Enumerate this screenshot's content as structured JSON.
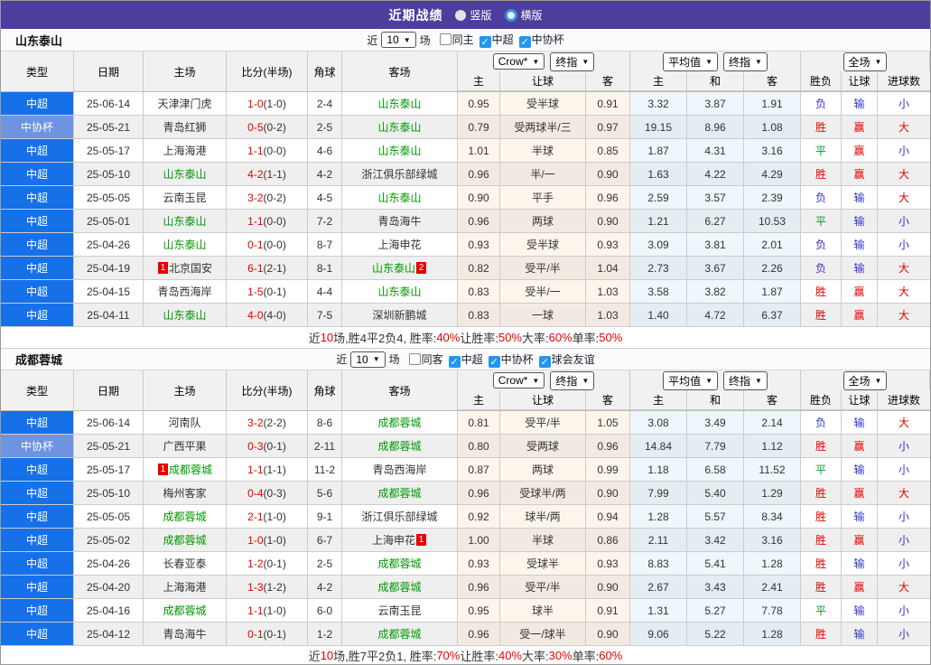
{
  "title_bar": {
    "title": "近期战绩",
    "radios": [
      {
        "label": "竖版",
        "selected": false
      },
      {
        "label": "横版",
        "selected": true
      }
    ]
  },
  "colors": {
    "result_map": {
      "r": "#e60000",
      "g": "#009933",
      "b": "#3333cc"
    },
    "team_green": "#009900",
    "league_bg": "#1670e8",
    "cup_bg": "#6e93e0",
    "accent_purple": "#4c3f9c",
    "checkbox_blue": "#2196f3",
    "score_red": "#e60000"
  },
  "table_header": {
    "cols": [
      "类型",
      "日期",
      "主场",
      "比分(半场)",
      "角球",
      "客场"
    ],
    "groups": [
      {
        "col": 7,
        "selects": [
          "Crow*",
          "终指"
        ]
      },
      {
        "col": 10,
        "selects": [
          "平均值",
          "终指"
        ]
      },
      {
        "col": 13,
        "selects": [
          "全场"
        ]
      }
    ],
    "sub": [
      "主",
      "让球",
      "客",
      "主",
      "和",
      "客",
      "胜负",
      "让球",
      "进球数"
    ]
  },
  "sections": [
    {
      "team": "山东泰山",
      "filters": {
        "prefix": "近",
        "count": "10",
        "suffix": "场",
        "checkboxes": [
          {
            "label": "同主",
            "checked": false
          },
          {
            "label": "中超",
            "checked": true
          },
          {
            "label": "中协杯",
            "checked": true
          }
        ]
      },
      "rows": [
        {
          "type": "中超",
          "cup": false,
          "date": "25-06-14",
          "home": {
            "name": "天津津门虎",
            "green": false
          },
          "score": "1-0",
          "half": "(1-0)",
          "corner": "2-4",
          "away": {
            "name": "山东泰山",
            "green": true
          },
          "o1": "0.95",
          "line": "受半球",
          "o2": "0.91",
          "a1": "3.32",
          "a2": "3.87",
          "a3": "1.91",
          "res": {
            "t": "负",
            "c": "b"
          },
          "hres": {
            "t": "输",
            "c": "b"
          },
          "gres": {
            "t": "小",
            "c": "b"
          }
        },
        {
          "type": "中协杯",
          "cup": true,
          "date": "25-05-21",
          "home": {
            "name": "青岛红狮",
            "green": false
          },
          "score": "0-5",
          "half": "(0-2)",
          "corner": "2-5",
          "away": {
            "name": "山东泰山",
            "green": true
          },
          "o1": "0.79",
          "line": "受两球半/三",
          "o2": "0.97",
          "a1": "19.15",
          "a2": "8.96",
          "a3": "1.08",
          "res": {
            "t": "胜",
            "c": "r"
          },
          "hres": {
            "t": "赢",
            "c": "r"
          },
          "gres": {
            "t": "大",
            "c": "r"
          }
        },
        {
          "type": "中超",
          "cup": false,
          "date": "25-05-17",
          "home": {
            "name": "上海海港",
            "green": false
          },
          "score": "1-1",
          "half": "(0-0)",
          "corner": "4-6",
          "away": {
            "name": "山东泰山",
            "green": true
          },
          "o1": "1.01",
          "line": "半球",
          "o2": "0.85",
          "a1": "1.87",
          "a2": "4.31",
          "a3": "3.16",
          "res": {
            "t": "平",
            "c": "g"
          },
          "hres": {
            "t": "赢",
            "c": "r"
          },
          "gres": {
            "t": "小",
            "c": "b"
          }
        },
        {
          "type": "中超",
          "cup": false,
          "date": "25-05-10",
          "home": {
            "name": "山东泰山",
            "green": true
          },
          "score": "4-2",
          "half": "(1-1)",
          "corner": "4-2",
          "away": {
            "name": "浙江俱乐部绿城",
            "green": false
          },
          "o1": "0.96",
          "line": "半/一",
          "o2": "0.90",
          "a1": "1.63",
          "a2": "4.22",
          "a3": "4.29",
          "res": {
            "t": "胜",
            "c": "r"
          },
          "hres": {
            "t": "赢",
            "c": "r"
          },
          "gres": {
            "t": "大",
            "c": "r"
          }
        },
        {
          "type": "中超",
          "cup": false,
          "date": "25-05-05",
          "home": {
            "name": "云南玉昆",
            "green": false
          },
          "score": "3-2",
          "half": "(0-2)",
          "corner": "4-5",
          "away": {
            "name": "山东泰山",
            "green": true
          },
          "o1": "0.90",
          "line": "平手",
          "o2": "0.96",
          "a1": "2.59",
          "a2": "3.57",
          "a3": "2.39",
          "res": {
            "t": "负",
            "c": "b"
          },
          "hres": {
            "t": "输",
            "c": "b"
          },
          "gres": {
            "t": "大",
            "c": "r"
          }
        },
        {
          "type": "中超",
          "cup": false,
          "date": "25-05-01",
          "home": {
            "name": "山东泰山",
            "green": true
          },
          "score": "1-1",
          "half": "(0-0)",
          "corner": "7-2",
          "away": {
            "name": "青岛海牛",
            "green": false
          },
          "o1": "0.96",
          "line": "两球",
          "o2": "0.90",
          "a1": "1.21",
          "a2": "6.27",
          "a3": "10.53",
          "res": {
            "t": "平",
            "c": "g"
          },
          "hres": {
            "t": "输",
            "c": "b"
          },
          "gres": {
            "t": "小",
            "c": "b"
          }
        },
        {
          "type": "中超",
          "cup": false,
          "date": "25-04-26",
          "home": {
            "name": "山东泰山",
            "green": true
          },
          "score": "0-1",
          "half": "(0-0)",
          "corner": "8-7",
          "away": {
            "name": "上海申花",
            "green": false
          },
          "o1": "0.93",
          "line": "受半球",
          "o2": "0.93",
          "a1": "3.09",
          "a2": "3.81",
          "a3": "2.01",
          "res": {
            "t": "负",
            "c": "b"
          },
          "hres": {
            "t": "输",
            "c": "b"
          },
          "gres": {
            "t": "小",
            "c": "b"
          }
        },
        {
          "type": "中超",
          "cup": false,
          "date": "25-04-19",
          "home": {
            "name": "北京国安",
            "green": false,
            "badge_before": "1"
          },
          "score": "6-1",
          "half": "(2-1)",
          "corner": "8-1",
          "away": {
            "name": "山东泰山",
            "green": true,
            "badge_after": "2"
          },
          "o1": "0.82",
          "line": "受平/半",
          "o2": "1.04",
          "a1": "2.73",
          "a2": "3.67",
          "a3": "2.26",
          "res": {
            "t": "负",
            "c": "b"
          },
          "hres": {
            "t": "输",
            "c": "b"
          },
          "gres": {
            "t": "大",
            "c": "r"
          }
        },
        {
          "type": "中超",
          "cup": false,
          "date": "25-04-15",
          "home": {
            "name": "青岛西海岸",
            "green": false
          },
          "score": "1-5",
          "half": "(0-1)",
          "corner": "4-4",
          "away": {
            "name": "山东泰山",
            "green": true
          },
          "o1": "0.83",
          "line": "受半/一",
          "o2": "1.03",
          "a1": "3.58",
          "a2": "3.82",
          "a3": "1.87",
          "res": {
            "t": "胜",
            "c": "r"
          },
          "hres": {
            "t": "赢",
            "c": "r"
          },
          "gres": {
            "t": "大",
            "c": "r"
          }
        },
        {
          "type": "中超",
          "cup": false,
          "date": "25-04-11",
          "home": {
            "name": "山东泰山",
            "green": true
          },
          "score": "4-0",
          "half": "(4-0)",
          "corner": "7-5",
          "away": {
            "name": "深圳新鹏城",
            "green": false
          },
          "o1": "0.83",
          "line": "一球",
          "o2": "1.03",
          "a1": "1.40",
          "a2": "4.72",
          "a3": "6.37",
          "res": {
            "t": "胜",
            "c": "r"
          },
          "hres": {
            "t": "赢",
            "c": "r"
          },
          "gres": {
            "t": "大",
            "c": "r"
          }
        }
      ],
      "summary": [
        {
          "t": "近"
        },
        {
          "t": "10",
          "red": true
        },
        {
          "t": "场,胜4平2负4, 胜率:"
        },
        {
          "t": "40%",
          "red": true
        },
        {
          "t": " 让胜率:"
        },
        {
          "t": "50%",
          "red": true
        },
        {
          "t": " 大率:"
        },
        {
          "t": "60%",
          "red": true
        },
        {
          "t": " 单率:"
        },
        {
          "t": "50%",
          "red": true
        }
      ]
    },
    {
      "team": "成都蓉城",
      "filters": {
        "prefix": "近",
        "count": "10",
        "suffix": "场",
        "checkboxes": [
          {
            "label": "同客",
            "checked": false
          },
          {
            "label": "中超",
            "checked": true
          },
          {
            "label": "中协杯",
            "checked": true
          },
          {
            "label": "球会友谊",
            "checked": true
          }
        ]
      },
      "rows": [
        {
          "type": "中超",
          "cup": false,
          "date": "25-06-14",
          "home": {
            "name": "河南队",
            "green": false
          },
          "score": "3-2",
          "half": "(2-2)",
          "corner": "8-6",
          "away": {
            "name": "成都蓉城",
            "green": true
          },
          "o1": "0.81",
          "line": "受平/半",
          "o2": "1.05",
          "a1": "3.08",
          "a2": "3.49",
          "a3": "2.14",
          "res": {
            "t": "负",
            "c": "b"
          },
          "hres": {
            "t": "输",
            "c": "b"
          },
          "gres": {
            "t": "大",
            "c": "r"
          }
        },
        {
          "type": "中协杯",
          "cup": true,
          "date": "25-05-21",
          "home": {
            "name": "广西平果",
            "green": false
          },
          "score": "0-3",
          "half": "(0-1)",
          "corner": "2-11",
          "away": {
            "name": "成都蓉城",
            "green": true
          },
          "o1": "0.80",
          "line": "受两球",
          "o2": "0.96",
          "a1": "14.84",
          "a2": "7.79",
          "a3": "1.12",
          "res": {
            "t": "胜",
            "c": "r"
          },
          "hres": {
            "t": "赢",
            "c": "r"
          },
          "gres": {
            "t": "小",
            "c": "b"
          }
        },
        {
          "type": "中超",
          "cup": false,
          "date": "25-05-17",
          "home": {
            "name": "成都蓉城",
            "green": true,
            "badge_before": "1"
          },
          "score": "1-1",
          "half": "(1-1)",
          "corner": "11-2",
          "away": {
            "name": "青岛西海岸",
            "green": false
          },
          "o1": "0.87",
          "line": "两球",
          "o2": "0.99",
          "a1": "1.18",
          "a2": "6.58",
          "a3": "11.52",
          "res": {
            "t": "平",
            "c": "g"
          },
          "hres": {
            "t": "输",
            "c": "b"
          },
          "gres": {
            "t": "小",
            "c": "b"
          }
        },
        {
          "type": "中超",
          "cup": false,
          "date": "25-05-10",
          "home": {
            "name": "梅州客家",
            "green": false
          },
          "score": "0-4",
          "half": "(0-3)",
          "corner": "5-6",
          "away": {
            "name": "成都蓉城",
            "green": true
          },
          "o1": "0.96",
          "line": "受球半/两",
          "o2": "0.90",
          "a1": "7.99",
          "a2": "5.40",
          "a3": "1.29",
          "res": {
            "t": "胜",
            "c": "r"
          },
          "hres": {
            "t": "赢",
            "c": "r"
          },
          "gres": {
            "t": "大",
            "c": "r"
          }
        },
        {
          "type": "中超",
          "cup": false,
          "date": "25-05-05",
          "home": {
            "name": "成都蓉城",
            "green": true
          },
          "score": "2-1",
          "half": "(1-0)",
          "corner": "9-1",
          "away": {
            "name": "浙江俱乐部绿城",
            "green": false
          },
          "o1": "0.92",
          "line": "球半/两",
          "o2": "0.94",
          "a1": "1.28",
          "a2": "5.57",
          "a3": "8.34",
          "res": {
            "t": "胜",
            "c": "r"
          },
          "hres": {
            "t": "输",
            "c": "b"
          },
          "gres": {
            "t": "小",
            "c": "b"
          }
        },
        {
          "type": "中超",
          "cup": false,
          "date": "25-05-02",
          "home": {
            "name": "成都蓉城",
            "green": true
          },
          "score": "1-0",
          "half": "(1-0)",
          "corner": "6-7",
          "away": {
            "name": "上海申花",
            "green": false,
            "badge_after": "1"
          },
          "o1": "1.00",
          "line": "半球",
          "o2": "0.86",
          "a1": "2.11",
          "a2": "3.42",
          "a3": "3.16",
          "res": {
            "t": "胜",
            "c": "r"
          },
          "hres": {
            "t": "赢",
            "c": "r"
          },
          "gres": {
            "t": "小",
            "c": "b"
          }
        },
        {
          "type": "中超",
          "cup": false,
          "date": "25-04-26",
          "home": {
            "name": "长春亚泰",
            "green": false
          },
          "score": "1-2",
          "half": "(0-1)",
          "corner": "2-5",
          "away": {
            "name": "成都蓉城",
            "green": true
          },
          "o1": "0.93",
          "line": "受球半",
          "o2": "0.93",
          "a1": "8.83",
          "a2": "5.41",
          "a3": "1.28",
          "res": {
            "t": "胜",
            "c": "r"
          },
          "hres": {
            "t": "输",
            "c": "b"
          },
          "gres": {
            "t": "小",
            "c": "b"
          }
        },
        {
          "type": "中超",
          "cup": false,
          "date": "25-04-20",
          "home": {
            "name": "上海海港",
            "green": false
          },
          "score": "1-3",
          "half": "(1-2)",
          "corner": "4-2",
          "away": {
            "name": "成都蓉城",
            "green": true
          },
          "o1": "0.96",
          "line": "受平/半",
          "o2": "0.90",
          "a1": "2.67",
          "a2": "3.43",
          "a3": "2.41",
          "res": {
            "t": "胜",
            "c": "r"
          },
          "hres": {
            "t": "赢",
            "c": "r"
          },
          "gres": {
            "t": "大",
            "c": "r"
          }
        },
        {
          "type": "中超",
          "cup": false,
          "date": "25-04-16",
          "home": {
            "name": "成都蓉城",
            "green": true
          },
          "score": "1-1",
          "half": "(1-0)",
          "corner": "6-0",
          "away": {
            "name": "云南玉昆",
            "green": false
          },
          "o1": "0.95",
          "line": "球半",
          "o2": "0.91",
          "a1": "1.31",
          "a2": "5.27",
          "a3": "7.78",
          "res": {
            "t": "平",
            "c": "g"
          },
          "hres": {
            "t": "输",
            "c": "b"
          },
          "gres": {
            "t": "小",
            "c": "b"
          }
        },
        {
          "type": "中超",
          "cup": false,
          "date": "25-04-12",
          "home": {
            "name": "青岛海牛",
            "green": false
          },
          "score": "0-1",
          "half": "(0-1)",
          "corner": "1-2",
          "away": {
            "name": "成都蓉城",
            "green": true
          },
          "o1": "0.96",
          "line": "受一/球半",
          "o2": "0.90",
          "a1": "9.06",
          "a2": "5.22",
          "a3": "1.28",
          "res": {
            "t": "胜",
            "c": "r"
          },
          "hres": {
            "t": "输",
            "c": "b"
          },
          "gres": {
            "t": "小",
            "c": "b"
          }
        }
      ],
      "summary": [
        {
          "t": "近"
        },
        {
          "t": "10",
          "red": true
        },
        {
          "t": "场,胜7平2负1, 胜率:"
        },
        {
          "t": "70%",
          "red": true
        },
        {
          "t": " 让胜率:"
        },
        {
          "t": "40%",
          "red": true
        },
        {
          "t": " 大率:"
        },
        {
          "t": "30%",
          "red": true
        },
        {
          "t": " 单率:"
        },
        {
          "t": "60%",
          "red": true
        }
      ]
    }
  ]
}
